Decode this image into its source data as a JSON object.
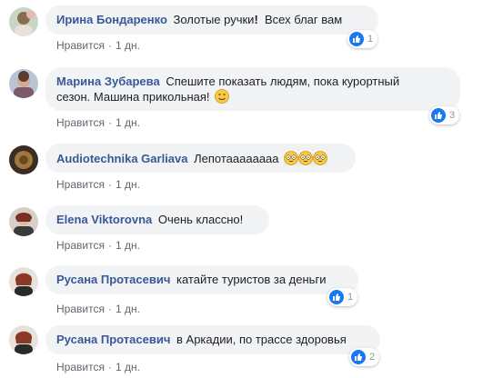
{
  "comments": [
    {
      "author": "Ирина Бондаренко",
      "text": "Золотые ручки",
      "text_tail": "  Всех благ вам",
      "mark": "!",
      "like_label": "Нравится",
      "separator": "·",
      "time": "1 дн.",
      "reactions": "1"
    },
    {
      "author": "Марина Зубарева",
      "text": "Спешите показать людям, пока курортный",
      "text_line2": "сезон. Машина прикольная!",
      "like_label": "Нравится",
      "separator": "·",
      "time": "1 дн.",
      "reactions": "3"
    },
    {
      "author": "Audiotechnika Garliava",
      "text": "Лепотаааааааа",
      "like_label": "Нравится",
      "separator": "·",
      "time": "1 дн."
    },
    {
      "author": "Elena Viktorovna",
      "text": "Очень классно!",
      "like_label": "Нравится",
      "separator": "·",
      "time": "1 дн."
    },
    {
      "author": "Русана Протасевич",
      "text": "катайте туристов за деньги",
      "like_label": "Нравится",
      "separator": "·",
      "time": "1 дн.",
      "reactions": "1"
    },
    {
      "author": "Русана Протасевич",
      "text": "в Аркадии, по трассе здоровья",
      "like_label": "Нравится",
      "separator": "·",
      "time": "1 дн.",
      "reactions": "2"
    }
  ],
  "colors": {
    "author": "#385898",
    "bubble": "#f2f3f5",
    "meta": "#606770",
    "like_badge": "#1877f2"
  },
  "icons": {
    "like": "like-thumb-icon",
    "smile": "smile-emoji-icon",
    "flushed": "flushed-emoji-icon"
  }
}
